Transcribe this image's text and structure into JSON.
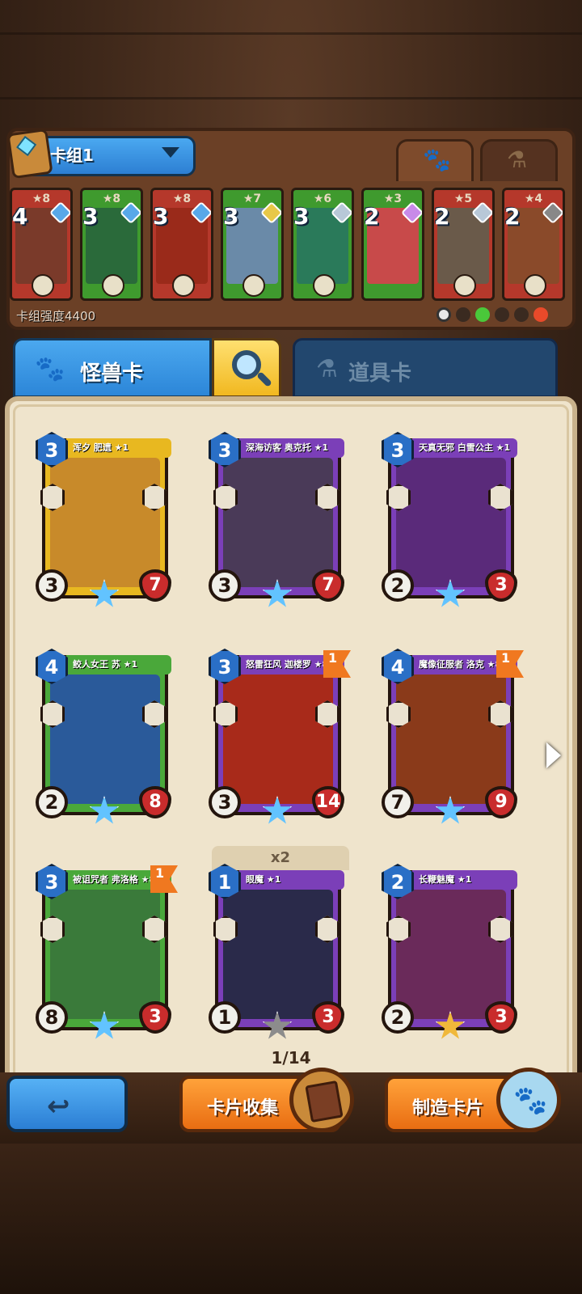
{
  "deck": {
    "name": "卡组1",
    "power_label": "卡组强度4400",
    "cards": [
      {
        "stars": "★8",
        "cost": "4",
        "color": "red"
      },
      {
        "stars": "★8",
        "cost": "3",
        "color": "green"
      },
      {
        "stars": "★8",
        "cost": "3",
        "color": "red"
      },
      {
        "stars": "★7",
        "cost": "3",
        "color": "green"
      },
      {
        "stars": "★6",
        "cost": "3",
        "color": "green"
      },
      {
        "stars": "★3",
        "cost": "2",
        "color": "green"
      },
      {
        "stars": "★5",
        "cost": "2",
        "color": "red"
      },
      {
        "stars": "★4",
        "cost": "2",
        "color": "red"
      }
    ]
  },
  "tabs": {
    "monster": "怪兽卡",
    "items": "道具卡"
  },
  "collection": {
    "duplicate_label": "x2",
    "page": "1/14",
    "cards": [
      {
        "name": "浑夕 肥遗 ★1",
        "cost": "3",
        "atk": "3",
        "hp": "7",
        "band": "#e8b820",
        "art": "#c88a2a"
      },
      {
        "name": "深海访客 奥克托 ★1",
        "cost": "3",
        "atk": "3",
        "hp": "7",
        "band": "#7b3fb8",
        "art": "#4a3a58"
      },
      {
        "name": "天真无邪 白雪公主 ★1",
        "cost": "3",
        "atk": "2",
        "hp": "3",
        "band": "#7b3fb8",
        "art": "#5a2a7a"
      },
      {
        "name": "鲛人女王 苏 ★1",
        "cost": "4",
        "atk": "2",
        "hp": "8",
        "band": "#4aa83a",
        "art": "#2a5a9a"
      },
      {
        "name": "怒雷狂风 迦楼罗 ★8",
        "cost": "3",
        "atk": "3",
        "hp": "14",
        "band": "#7b3fb8",
        "art": "#a82a1a",
        "flag": "1"
      },
      {
        "name": "魔像征服者 洛克 ★8",
        "cost": "4",
        "atk": "7",
        "hp": "9",
        "band": "#7b3fb8",
        "art": "#8a3a1a",
        "flag": "1"
      },
      {
        "name": "被诅咒者 弗洛格 ★8",
        "cost": "3",
        "atk": "8",
        "hp": "3",
        "band": "#4aa83a",
        "art": "#3a7a3a",
        "flag": "1"
      },
      {
        "name": "眼魔 ★1",
        "cost": "1",
        "atk": "1",
        "hp": "3",
        "band": "#7b3fb8",
        "art": "#2a2a4a"
      },
      {
        "name": "长鞭魅魔 ★1",
        "cost": "2",
        "atk": "2",
        "hp": "3",
        "band": "#7b3fb8",
        "art": "#6a2a5a"
      }
    ]
  },
  "buttons": {
    "collect": "卡片收集",
    "craft": "制造卡片"
  },
  "icons": {
    "back": "back-arrow-icon",
    "search": "magnifier-icon",
    "paw": "paw-icon",
    "potion": "potion-icon"
  }
}
